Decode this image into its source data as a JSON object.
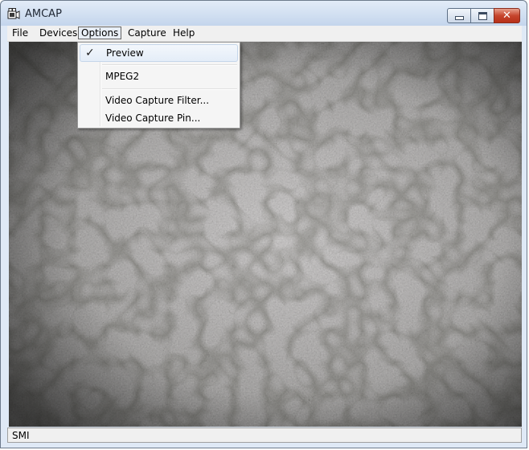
{
  "window": {
    "title": "AMCAP",
    "close_glyph": "✕"
  },
  "menubar": {
    "items": [
      {
        "label": "File"
      },
      {
        "label": "Devices"
      },
      {
        "label": "Options"
      },
      {
        "label": "Capture"
      },
      {
        "label": "Help"
      }
    ]
  },
  "options_menu": {
    "items": [
      {
        "label": "Preview",
        "checked": true,
        "check_glyph": "✓"
      },
      {
        "label": "MPEG2"
      },
      {
        "label": "Video Capture Filter..."
      },
      {
        "label": "Video Capture Pin..."
      }
    ]
  },
  "status": {
    "text": "SMI"
  },
  "icons": {
    "app": "camera-icon",
    "minimize": "minimize-icon",
    "maximize": "maximize-icon",
    "close": "close-icon",
    "check": "check-icon"
  },
  "colors": {
    "close_button": "#c6452d",
    "titlebar": "#c9d9ee",
    "menu_background": "#f0f0f0"
  }
}
